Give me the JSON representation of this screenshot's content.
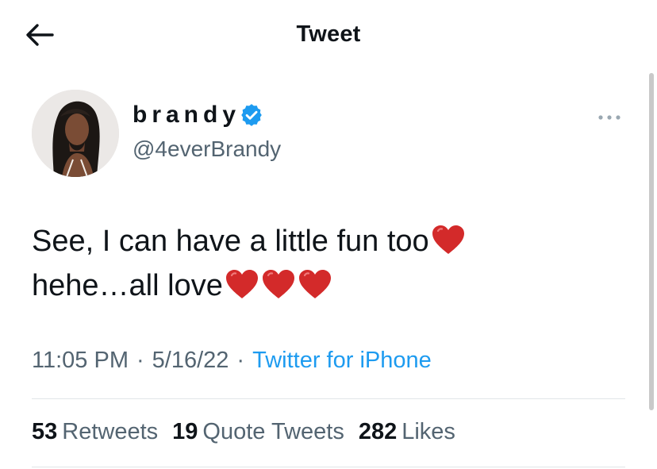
{
  "header": {
    "title": "Tweet",
    "back_icon": "arrow-left-icon"
  },
  "author": {
    "display_name": "brandy",
    "handle": "@4everBrandy",
    "verified": true,
    "verified_color": "#1d9bf0"
  },
  "tweet": {
    "lines": [
      "See, I can have a little fun too",
      "hehe…all love"
    ],
    "emoji": [
      "heart-icon"
    ]
  },
  "meta": {
    "time": "11:05 PM",
    "date": "5/16/22",
    "source": "Twitter for iPhone",
    "separator": "·"
  },
  "stats": {
    "retweets_count": "53",
    "retweets_label": "Retweets",
    "quote_count": "19",
    "quote_label": "Quote Tweets",
    "likes_count": "282",
    "likes_label": "Likes"
  },
  "colors": {
    "accent": "#1d9bf0",
    "secondary_text": "#536471",
    "heart": "#d32a2a"
  }
}
